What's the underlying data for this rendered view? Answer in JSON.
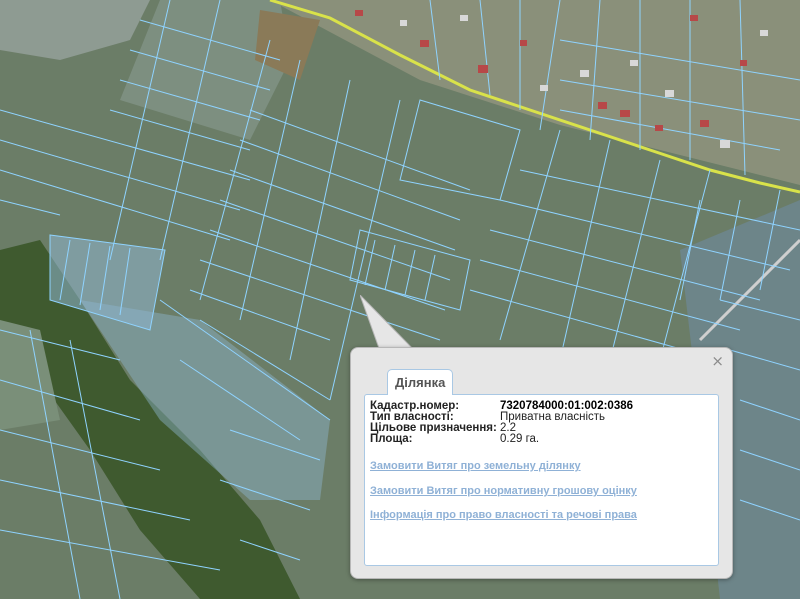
{
  "popup": {
    "tab_label": "Ділянка",
    "close_symbol": "×",
    "fields": [
      {
        "label": "Кадастр.номер:",
        "value": "7320784000:01:002:0386"
      },
      {
        "label": "Тип власності:",
        "value": "Приватна власність"
      },
      {
        "label": "Цільове призначення:",
        "value": "2.2"
      },
      {
        "label": "Площа:",
        "value": "0.29 га."
      }
    ],
    "links": [
      "Замовити Витяг про земельну ділянку",
      "Замовити Витяг про нормативну грошову оцінку",
      "Інформація про право власності та речові права"
    ]
  },
  "map": {
    "icons": [
      "close-icon"
    ],
    "colors": {
      "parcel_outline": "#8fd3ff",
      "road_highlight": "#d9e24a",
      "forest": "#3f5a2f",
      "field": "#6b7d67"
    }
  }
}
